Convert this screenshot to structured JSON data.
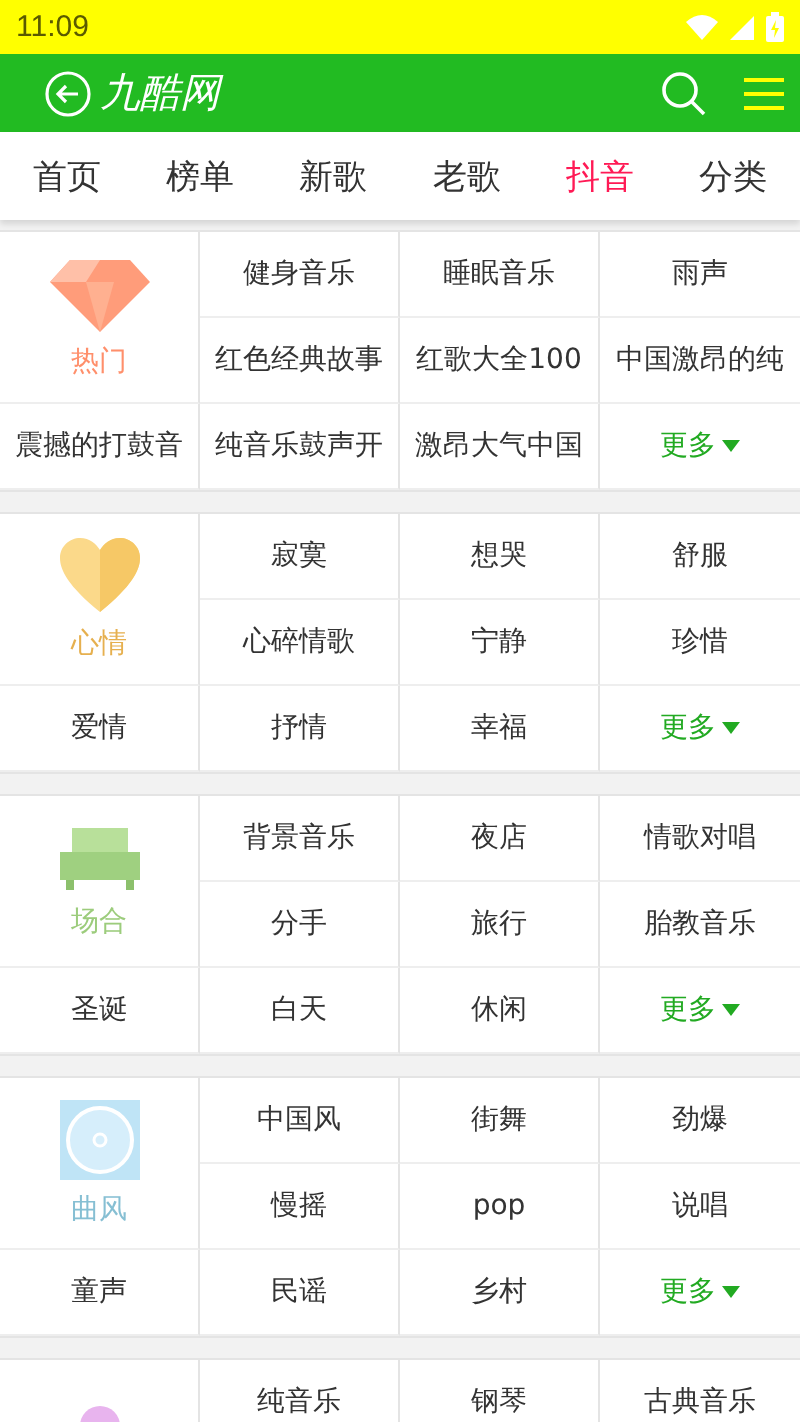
{
  "status_bar": {
    "time": "11:09"
  },
  "header": {
    "title": "九酷网"
  },
  "tabs": [
    {
      "label": "首页",
      "selected": false
    },
    {
      "label": "榜单",
      "selected": false
    },
    {
      "label": "新歌",
      "selected": false
    },
    {
      "label": "老歌",
      "selected": false
    },
    {
      "label": "抖音",
      "selected": true
    },
    {
      "label": "分类",
      "selected": false
    }
  ],
  "sections": [
    {
      "kind": "diamond",
      "label": "热门",
      "color": "#ff8f6b",
      "items": [
        "健身音乐",
        "睡眠音乐",
        "雨声",
        "红色经典故事",
        "红歌大全100",
        "中国激昂的纯",
        "震撼的打鼓音",
        "纯音乐鼓声开",
        "激昂大气中国"
      ],
      "more": "更多"
    },
    {
      "kind": "heart",
      "label": "心情",
      "color": "#e6b04f",
      "items": [
        "寂寞",
        "想哭",
        "舒服",
        "心碎情歌",
        "宁静",
        "珍惜",
        "爱情",
        "抒情",
        "幸福"
      ],
      "more": "更多"
    },
    {
      "kind": "sofa",
      "label": "场合",
      "color": "#9ccc7c",
      "items": [
        "背景音乐",
        "夜店",
        "情歌对唱",
        "分手",
        "旅行",
        "胎教音乐",
        "圣诞",
        "白天",
        "休闲"
      ],
      "more": "更多"
    },
    {
      "kind": "disc",
      "label": "曲风",
      "color": "#86bfd3",
      "items": [
        "中国风",
        "街舞",
        "劲爆",
        "慢摇",
        "pop",
        "说唱",
        "童声",
        "民谣",
        "乡村"
      ],
      "more": "更多"
    },
    {
      "kind": "mic",
      "items": [
        "纯音乐",
        "钢琴",
        "古典音乐"
      ]
    }
  ]
}
